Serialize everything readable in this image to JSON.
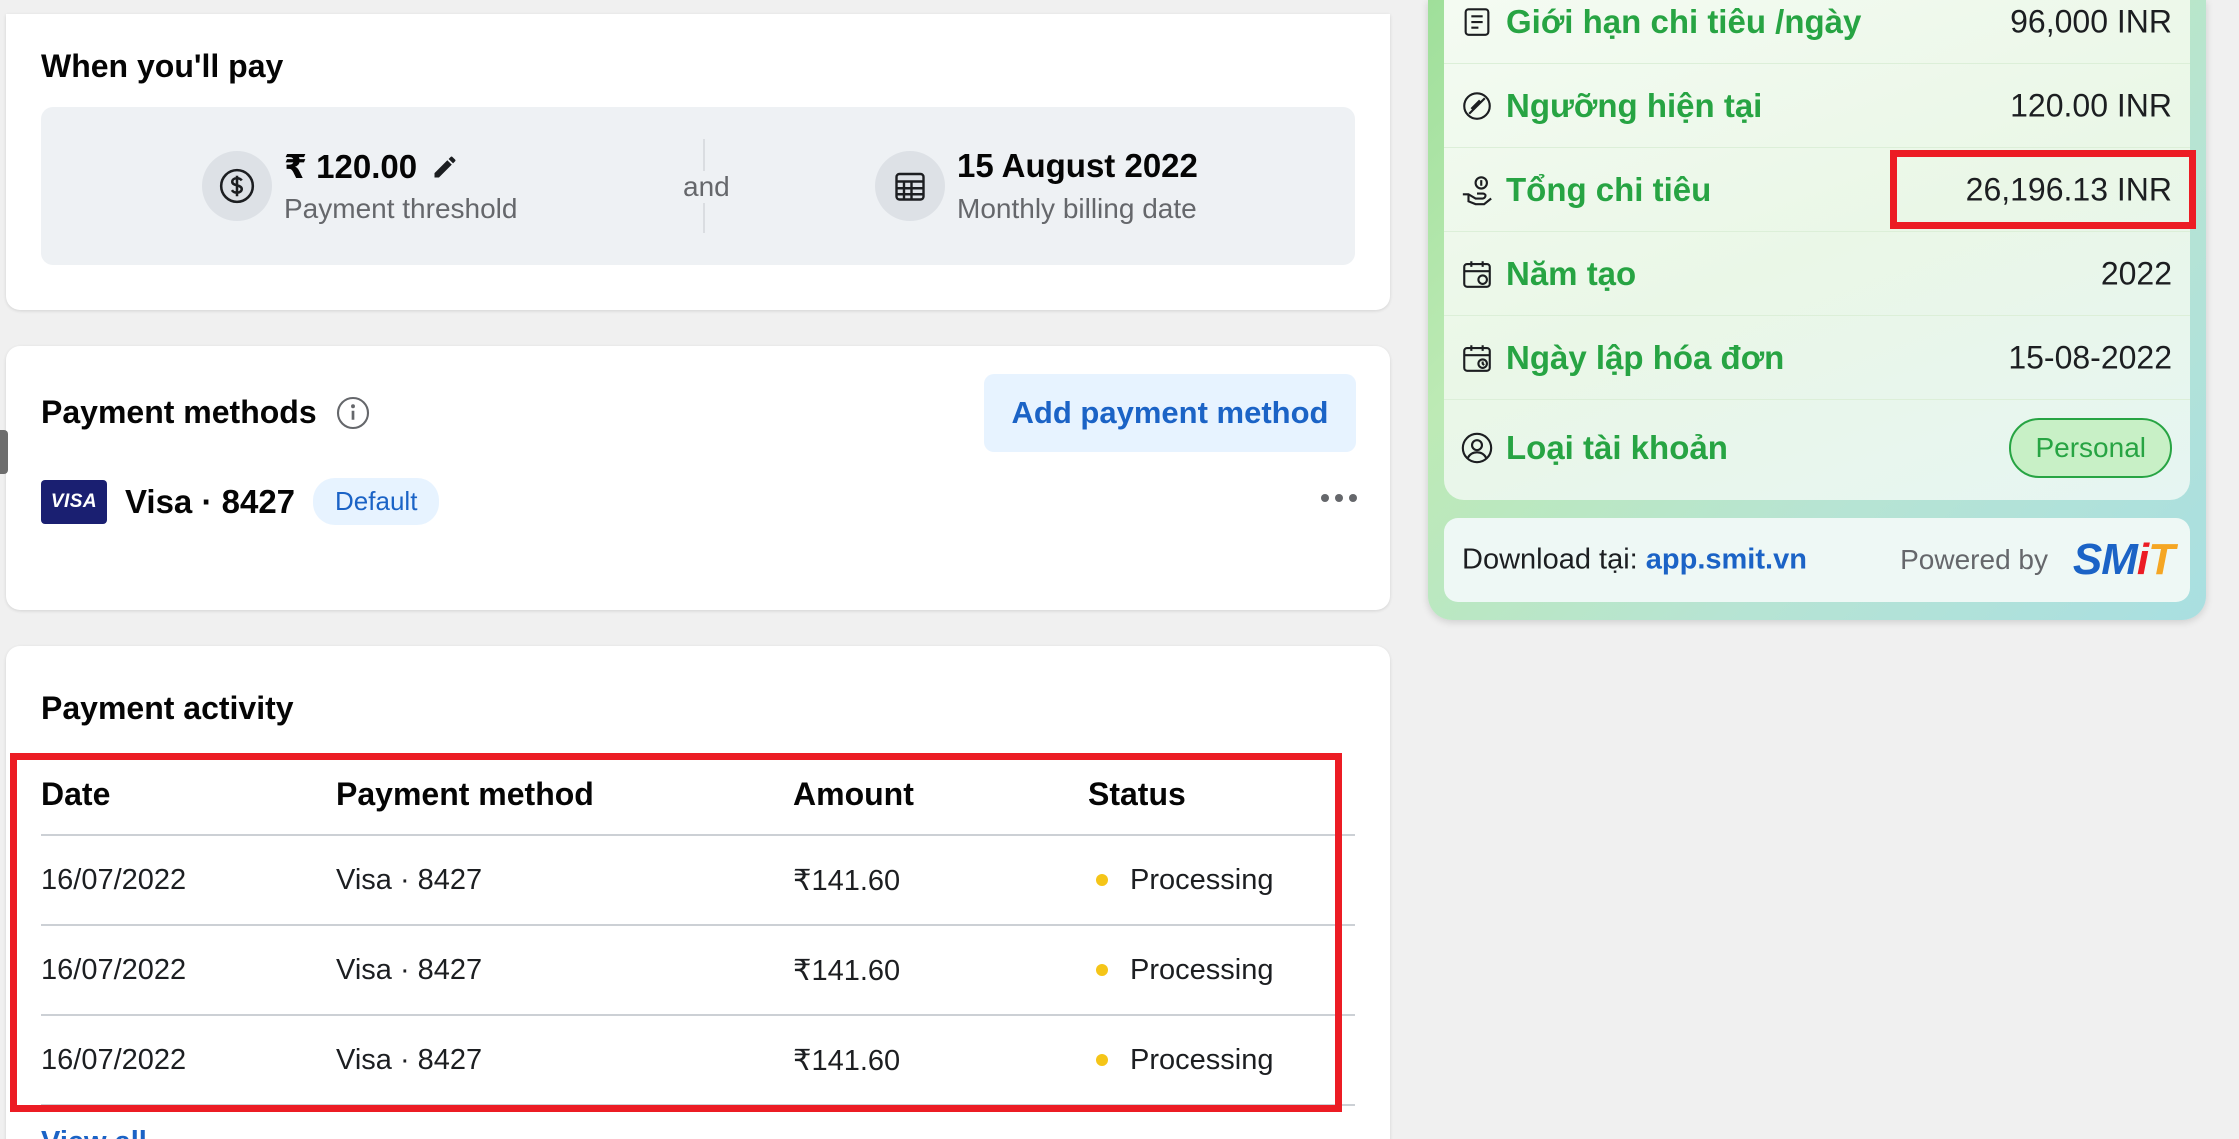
{
  "pay_card": {
    "title": "When you'll pay",
    "threshold_value": "₹ 120.00",
    "threshold_label": "Payment threshold",
    "and_text": "and",
    "billing_date": "15 August 2022",
    "billing_label": "Monthly billing date"
  },
  "methods_card": {
    "title": "Payment methods",
    "add_button": "Add payment method",
    "card_brand": "VISA",
    "card_label": "Visa · 8427",
    "default_badge": "Default"
  },
  "activity_card": {
    "title": "Payment activity",
    "headers": [
      "Date",
      "Payment method",
      "Amount",
      "Status"
    ],
    "rows": [
      {
        "date": "16/07/2022",
        "method": "Visa · 8427",
        "amount": "₹141.60",
        "status": "Processing"
      },
      {
        "date": "16/07/2022",
        "method": "Visa · 8427",
        "amount": "₹141.60",
        "status": "Processing"
      },
      {
        "date": "16/07/2022",
        "method": "Visa · 8427",
        "amount": "₹141.60",
        "status": "Processing"
      }
    ],
    "view_more": "View all"
  },
  "extension": {
    "rows": [
      {
        "label": "Giới hạn chi tiêu /ngày",
        "value": "96,000 INR",
        "icon": "list-icon"
      },
      {
        "label": "Ngưỡng hiện tại",
        "value": "120.00 INR",
        "icon": "threshold-icon"
      },
      {
        "label": "Tổng chi tiêu",
        "value": "26,196.13 INR",
        "icon": "money-hand-icon"
      },
      {
        "label": "Năm tạo",
        "value": "2022",
        "icon": "calendar-icon"
      },
      {
        "label": "Ngày lập hóa đơn",
        "value": "15-08-2022",
        "icon": "calendar-clock-icon"
      },
      {
        "label": "Loại tài khoản",
        "value": "Personal",
        "icon": "user-circle-icon"
      }
    ],
    "download_prefix": "Download tại: ",
    "download_link": "app.smit.vn",
    "powered_by": "Powered by",
    "logo_s": "SM",
    "logo_i": "i",
    "logo_t": "T"
  },
  "colors": {
    "accent_blue": "#1b63c6",
    "ext_green": "#27a443",
    "highlight_red": "#ec1c24",
    "status_yellow": "#f5c518"
  }
}
